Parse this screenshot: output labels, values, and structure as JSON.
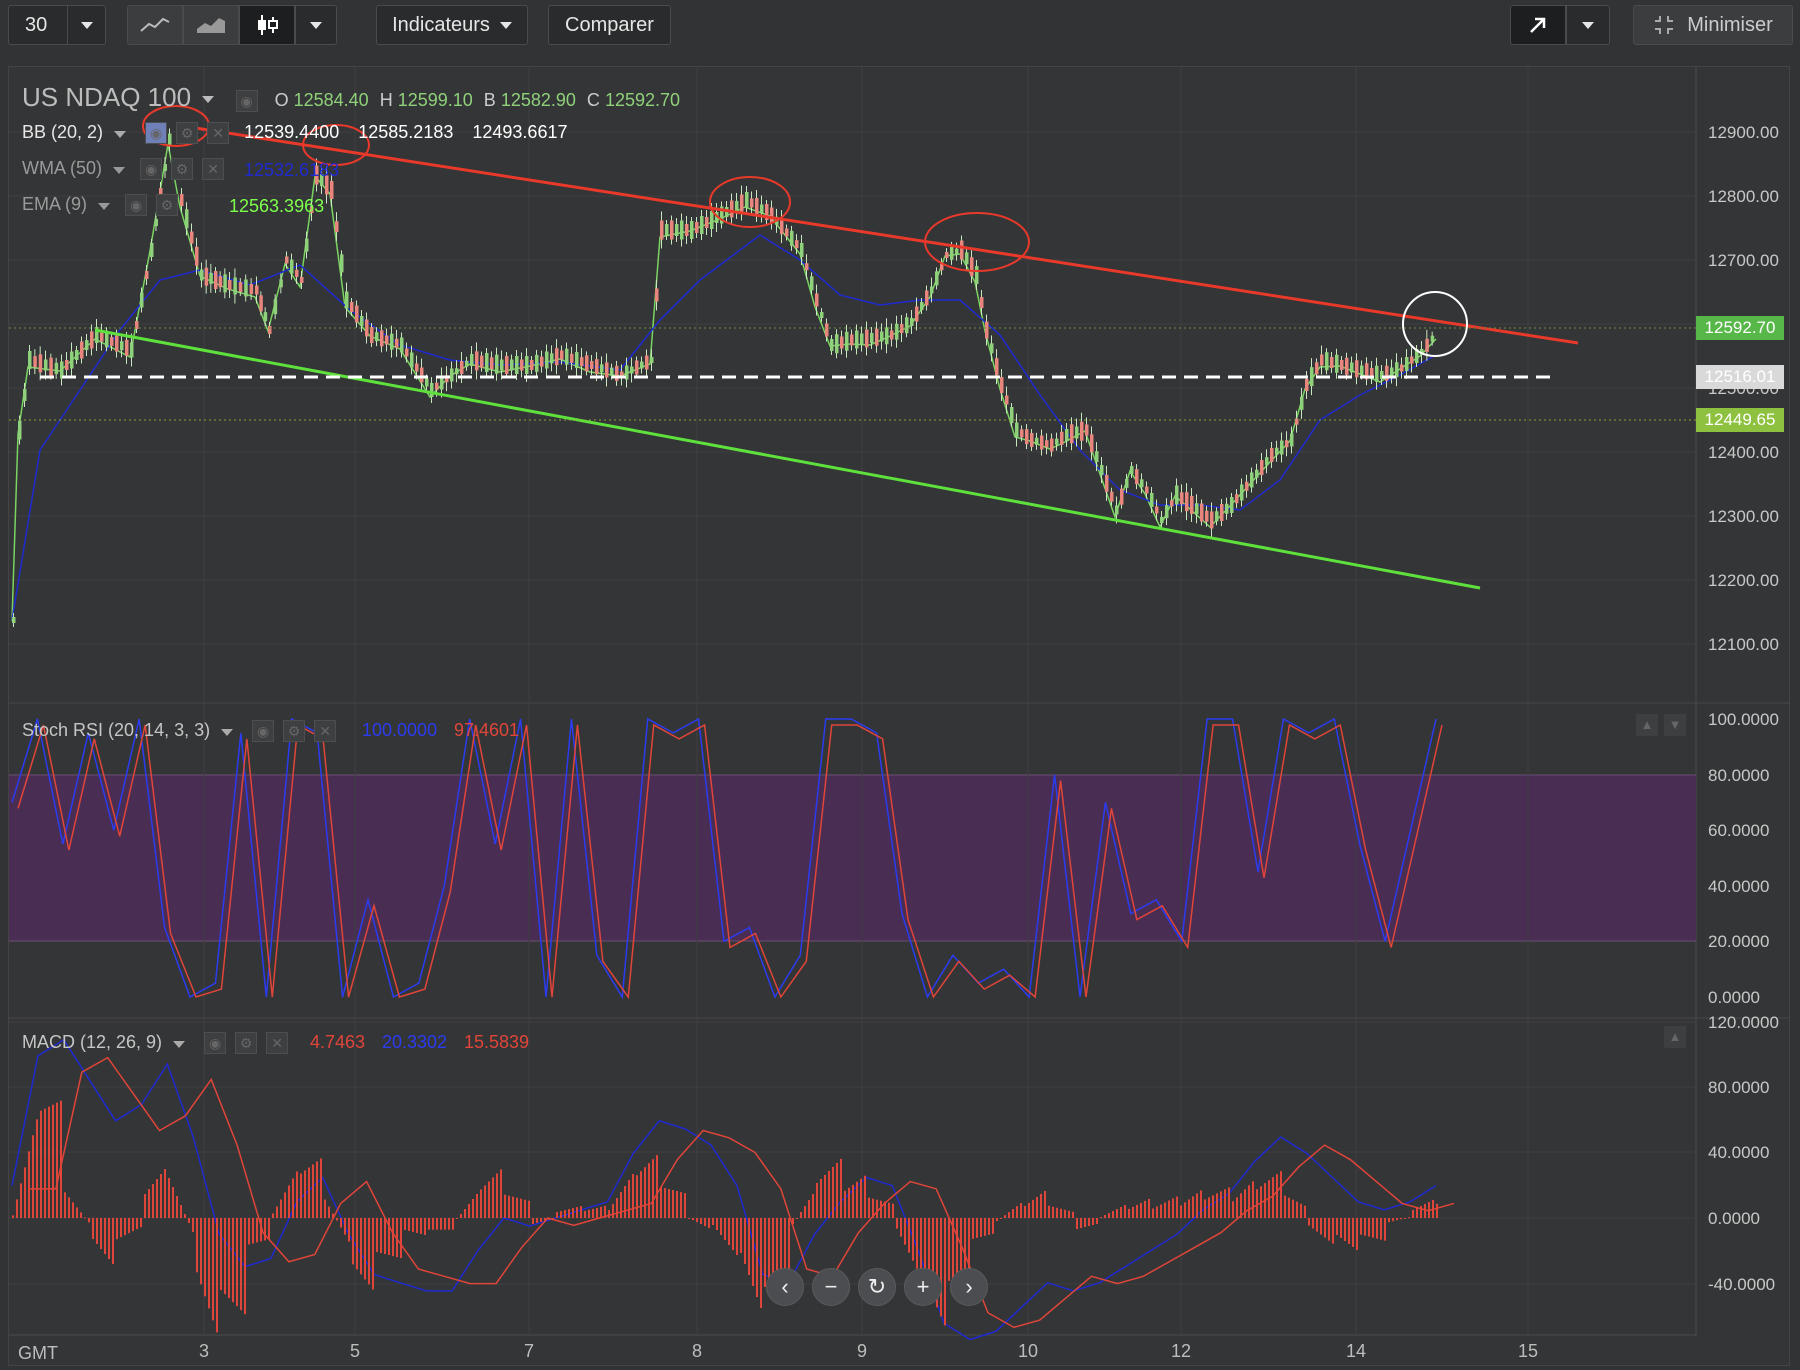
{
  "toolbar": {
    "interval": "30",
    "indicators_label": "Indicateurs",
    "compare_label": "Comparer",
    "minimize_label": "Minimiser"
  },
  "main": {
    "symbol": "US NDAQ 100",
    "ohlc": {
      "o_label": "O",
      "o": "12584.40",
      "h_label": "H",
      "h": "12599.10",
      "b_label": "B",
      "b": "12582.90",
      "c_label": "C",
      "c": "12592.70"
    },
    "bb": {
      "label": "BB (20, 2)",
      "v1": "12539.4400",
      "v2": "12585.2183",
      "v3": "12493.6617"
    },
    "wma": {
      "label": "WMA (50)",
      "value": "12532.6183"
    },
    "ema": {
      "label": "EMA (9)",
      "value": "12563.3963"
    },
    "price_ticks": [
      "12900.00",
      "12800.00",
      "12700.00",
      "12600.00",
      "12500.00",
      "12400.00",
      "12300.00",
      "12200.00",
      "12100.00"
    ],
    "price_tags": {
      "last": "12592.70",
      "level": "12516.01",
      "low": "12449.65"
    }
  },
  "stoch": {
    "label": "Stoch RSI (20, 14, 3, 3)",
    "k": "100.0000",
    "d": "97.4601",
    "ticks": [
      "100.0000",
      "80.0000",
      "60.0000",
      "40.0000",
      "20.0000",
      "0.0000"
    ]
  },
  "macd": {
    "label": "MACD (12, 26, 9)",
    "v1": "4.7463",
    "v2": "20.3302",
    "v3": "15.5839",
    "ticks": [
      "120.0000",
      "80.0000",
      "40.0000",
      "0.0000",
      "-40.0000"
    ]
  },
  "xaxis": {
    "timezone": "GMT",
    "labels": [
      "3",
      "5",
      "7",
      "8",
      "9",
      "10",
      "12",
      "14",
      "15"
    ]
  },
  "colors": {
    "up": "#8fd17a",
    "down": "#e0453a",
    "wma": "#1f2bd1",
    "trend_top": "#e8392b",
    "trend_bottom": "#5ee13c",
    "purple": "#4a2d52"
  }
}
